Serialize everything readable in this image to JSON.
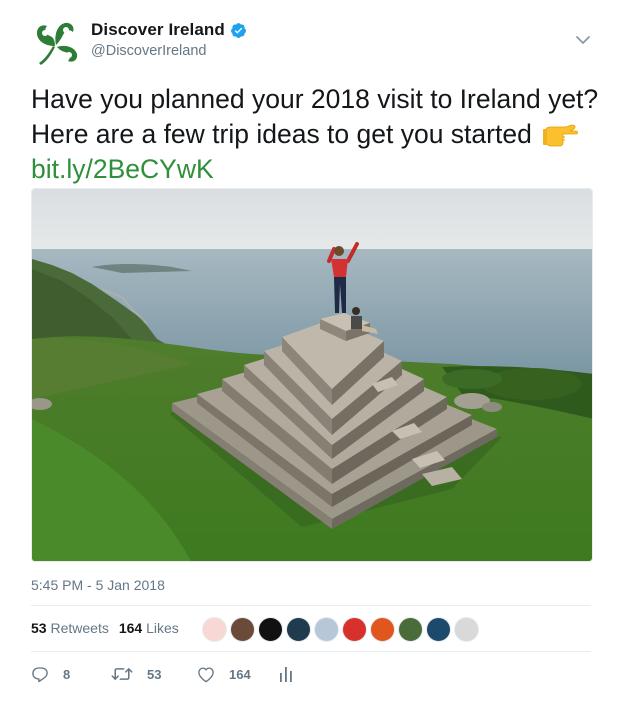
{
  "account": {
    "name": "Discover Ireland",
    "handle": "@DiscoverIreland",
    "verified": true,
    "brand_color": "#2e7d36"
  },
  "tweet": {
    "text_main": "Have you planned your 2018 visit to Ireland yet? Here are a few trip ideas to get you started",
    "emoji": "pointing-right-hand",
    "link_text": "bit.ly/2BeCYwK",
    "link_color": "#2f8f3a",
    "photo": "person-on-stone-pyramid-by-sea",
    "timestamp": "5:45 PM - 5 Jan 2018"
  },
  "stats": {
    "retweets_count": "53",
    "retweets_label": "Retweets",
    "likes_count": "164",
    "likes_label": "Likes",
    "liker_avatar_colors": [
      "#f7d8d4",
      "#6b4a3a",
      "#111111",
      "#1f3b4d",
      "#b7c6d8",
      "#d8302a",
      "#e0561c",
      "#4a6b3a",
      "#1d4a6b",
      "#d9d9d9"
    ]
  },
  "actions": {
    "reply_count": "8",
    "retweet_count": "53",
    "like_count": "164"
  }
}
